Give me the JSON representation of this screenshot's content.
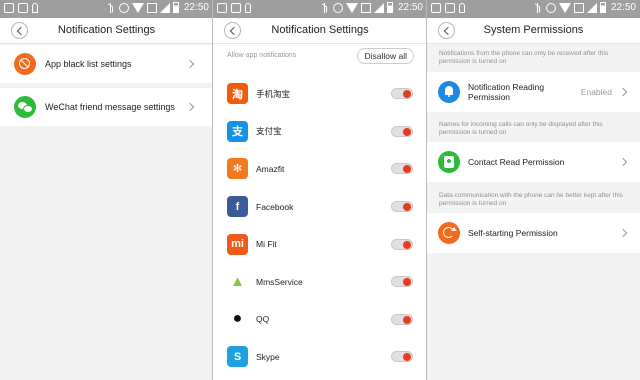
{
  "status_bar": {
    "time": "22:50"
  },
  "colors": {
    "orange": "#f26a1b",
    "green": "#2dbb3a",
    "blue": "#1e88e5",
    "toggle_red": "#e63b1e"
  },
  "screen1": {
    "title": "Notification Settings",
    "rows": [
      {
        "label": "App black list settings",
        "icon": "ban-icon"
      },
      {
        "label": "WeChat friend message settings",
        "icon": "wechat-icon"
      }
    ]
  },
  "screen2": {
    "title": "Notification Settings",
    "allow_label": "Allow app notifications",
    "disallow_all": "Disallow all",
    "apps": [
      {
        "name": "手机淘宝",
        "icon": "taobao-icon",
        "glyph": "淘",
        "color": "#f25a0c",
        "enabled": true
      },
      {
        "name": "支付宝",
        "icon": "alipay-icon",
        "glyph": "支",
        "color": "#1592e5",
        "enabled": true
      },
      {
        "name": "Amazfit",
        "icon": "amazfit-icon",
        "glyph": "✻",
        "color": "#f27a1f",
        "enabled": true
      },
      {
        "name": "Facebook",
        "icon": "facebook-icon",
        "glyph": "f",
        "color": "#3a5b9a",
        "enabled": true
      },
      {
        "name": "Mi Fit",
        "icon": "mifit-icon",
        "glyph": "mi",
        "color": "#f05a1a",
        "enabled": true
      },
      {
        "name": "MmsService",
        "icon": "android-icon",
        "glyph": "▲",
        "color": "#8bc34a",
        "enabled": true
      },
      {
        "name": "QQ",
        "icon": "qq-icon",
        "glyph": "●",
        "color": "#ffffff",
        "enabled": true
      },
      {
        "name": "Skype",
        "icon": "skype-icon",
        "glyph": "S",
        "color": "#1da1e0",
        "enabled": true
      }
    ]
  },
  "screen3": {
    "title": "System Permissions",
    "sections": [
      {
        "note": "Notifications from the phone can only be received after this permission is turned on",
        "label": "Notification Reading Permission",
        "status": "Enabled",
        "icon": "bell-icon"
      },
      {
        "note": "Names for incoming calls can only be displayed after this permission is turned on",
        "label": "Contact Read Permission",
        "status": "",
        "icon": "contact-icon"
      },
      {
        "note": "Data communication with the phone can be better kept after this permission is turned on",
        "label": "Self-starting Permission",
        "status": "",
        "icon": "self-start-icon"
      }
    ]
  }
}
